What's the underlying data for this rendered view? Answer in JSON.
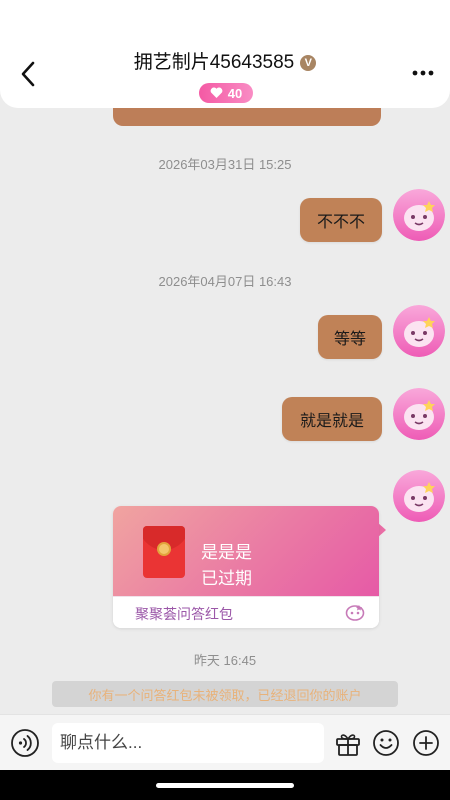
{
  "header": {
    "title": "拥艺制片45643585",
    "verified_mark": "V",
    "level": "40",
    "back_icon": "chevron-left-icon",
    "more_icon": "more-dots-icon"
  },
  "messages": {
    "ts1": "2026年03月31日 15:25",
    "msg1": "不不不",
    "ts2": "2026年04月07日 16:43",
    "msg2": "等等",
    "msg3": "就是就是",
    "red_packet": {
      "title": "是是是",
      "status": "已过期",
      "brand": "聚聚荟问答红包"
    },
    "ts3": "昨天 16:45",
    "notice": "你有一个问答红包未被领取，已经退回你的账户"
  },
  "input_bar": {
    "placeholder": "聊点什么..."
  },
  "colors": {
    "bubble": "#c08257",
    "accent_pink": "#f45aa4",
    "background": "#ececec"
  }
}
